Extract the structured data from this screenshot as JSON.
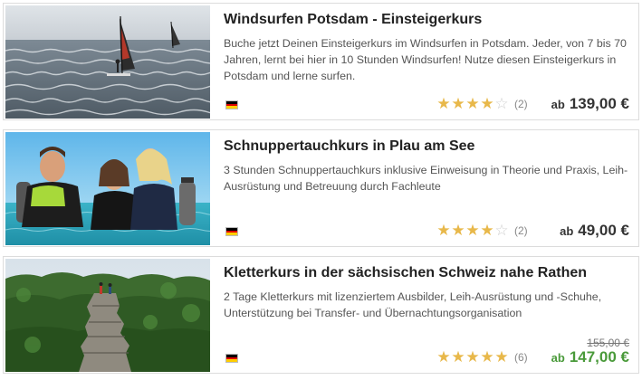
{
  "courses": [
    {
      "title": "Windsurfen Potsdam - Einsteigerkurs",
      "description": "Buche jetzt Deinen Einsteigerkurs im Windsurfen in Potsdam. Jeder, von 7 bis 70 Jahren, lernt bei hier in 10 Stunden Windsurfen! Nutze diesen Einsteigerkurs in Potsdam und lerne surfen.",
      "image": "windsurfing-photo",
      "flag": "german-flag",
      "rating": 4,
      "rating_max": 5,
      "rating_count": "(2)",
      "price_prefix": "ab",
      "price": "139,00 €"
    },
    {
      "title": "Schnuppertauchkurs in Plau am See",
      "description": "3 Stunden Schnuppertauchkurs inklusive Einweisung in Theorie und Praxis, Leih-Ausrüstung und Betreuung durch Fachleute",
      "image": "diving-photo",
      "flag": "german-flag",
      "rating": 4,
      "rating_max": 5,
      "rating_count": "(2)",
      "price_prefix": "ab",
      "price": "49,00 €"
    },
    {
      "title": "Kletterkurs in der sächsischen Schweiz nahe Rathen",
      "description": "2 Tage Kletterkurs mit lizenziertem Ausbilder, Leih-Ausrüstung und -Schuhe, Unterstützung bei Transfer- und Übernachtungsorganisation",
      "image": "climbing-photo",
      "flag": "german-flag",
      "rating": 5,
      "rating_max": 5,
      "rating_count": "(6)",
      "old_price": "155,00 €",
      "price_prefix": "ab",
      "price": "147,00 €"
    }
  ],
  "colors": {
    "star_full": "#e8b84a",
    "star_empty": "#cfcfcf",
    "sale_price": "#4a9a3a",
    "flag_black": "#000000",
    "flag_red": "#dd0000",
    "flag_gold": "#ffce00"
  }
}
